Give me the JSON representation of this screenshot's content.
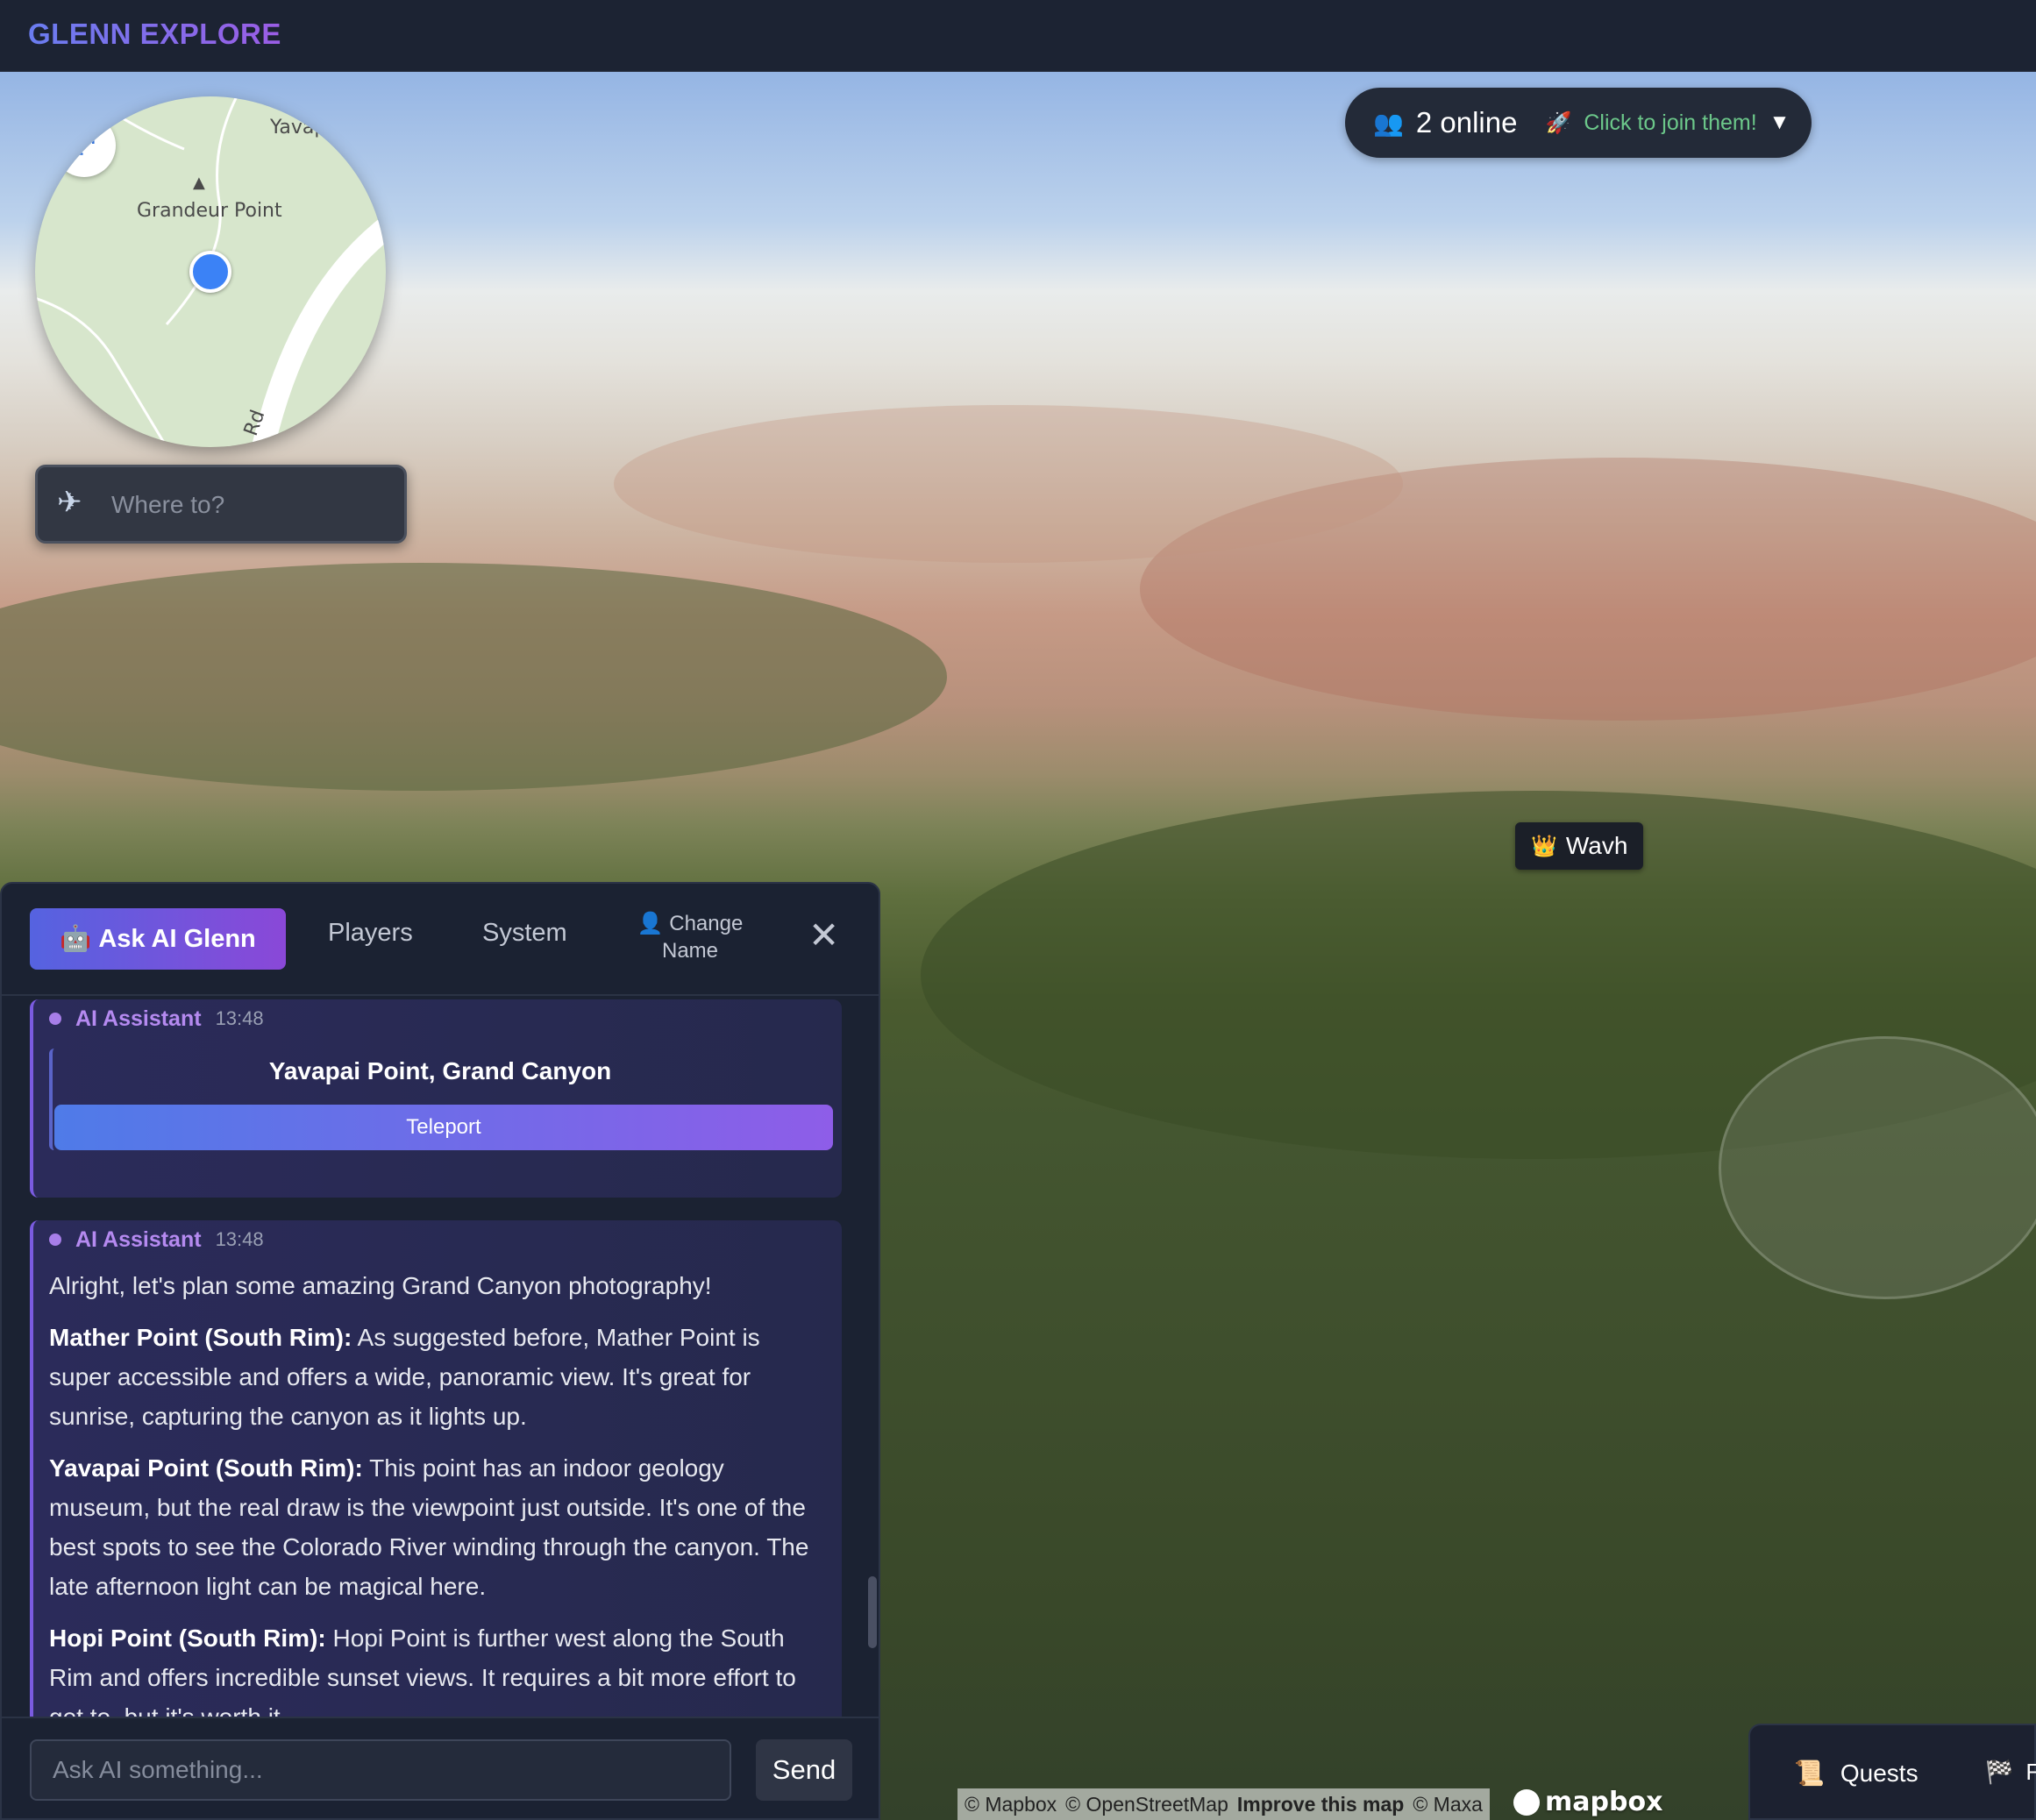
{
  "app": {
    "brand": "GLENN EXPLORE"
  },
  "minimap": {
    "expand_icon": "expand-arrows-icon",
    "labels": {
      "yavapai": "Yavap Mus",
      "grandeur": "Grandeur Point",
      "road": "Rd"
    }
  },
  "search": {
    "placeholder": "Where to?",
    "icon": "airplane-icon"
  },
  "online": {
    "count_label": "2 online",
    "join_label": "Click to join them!",
    "caret": "▼"
  },
  "player_tag": {
    "name": "Wavh",
    "icon": "crown-icon"
  },
  "chat": {
    "tabs": {
      "ai": "Ask AI Glenn",
      "players": "Players",
      "system": "System",
      "change_name": "Change Name"
    },
    "close_label": "✕",
    "messages": [
      {
        "sender": "AI Assistant",
        "time": "13:48",
        "card_title": "Yavapai Point, Grand Canyon",
        "button": "Teleport"
      },
      {
        "sender": "AI Assistant",
        "time": "13:48",
        "intro": "Alright, let's plan some amazing Grand Canyon photography!",
        "items": [
          {
            "title": "Mather Point (South Rim):",
            "text": "As suggested before, Mather Point is super accessible and offers a wide, panoramic view. It's great for sunrise, capturing the canyon as it lights up."
          },
          {
            "title": "Yavapai Point (South Rim):",
            "text": "This point has an indoor geology museum, but the real draw is the viewpoint just outside. It's one of the best spots to see the Colorado River winding through the canyon. The late afternoon light can be magical here."
          },
          {
            "title": "Hopi Point (South Rim):",
            "text": "Hopi Point is further west along the South Rim and offers incredible sunset views. It requires a bit more effort to get to, but it's worth it."
          }
        ]
      }
    ],
    "compose": {
      "placeholder": "Ask AI something...",
      "send": "Send"
    }
  },
  "questbar": {
    "quests": "Quests",
    "next": "F"
  },
  "attribution": {
    "mapbox": "© Mapbox",
    "osm": "© OpenStreetMap",
    "improve": "Improve this map",
    "maxar": "© Maxa",
    "logo_text": "mapbox"
  }
}
